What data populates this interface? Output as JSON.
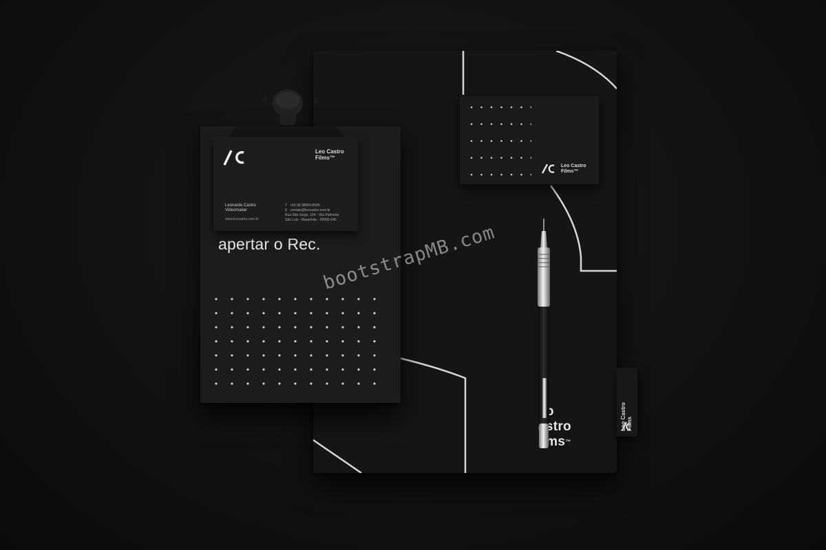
{
  "scene": {
    "background_color": "#111111",
    "accent_color": "#e6e6e6"
  },
  "notebook": {
    "brand": "Leo Castro\nFilms",
    "brand_partial": "eo\nastro\nilms",
    "trademark": "™"
  },
  "tab": {
    "brand": "Leo Castro\nFilms"
  },
  "card_small": {
    "brand": "Leo Castro\nFilms™"
  },
  "clipboard": {
    "tagline": "apertar o Rec."
  },
  "card_main": {
    "brand": "Leo Castro\nFilms™",
    "person": "Leonardo Castro\nVideomaker",
    "website": "www.leocastro.com.br",
    "contact": "T   +55 98 98069-8586\nE   contato@leocastro.com.br\nRua São Jorge, 164 - Vila Palmeira\nSão Luiz - Maranhão - 65065-645"
  },
  "watermark": {
    "text": "bootstrapMB.com"
  }
}
